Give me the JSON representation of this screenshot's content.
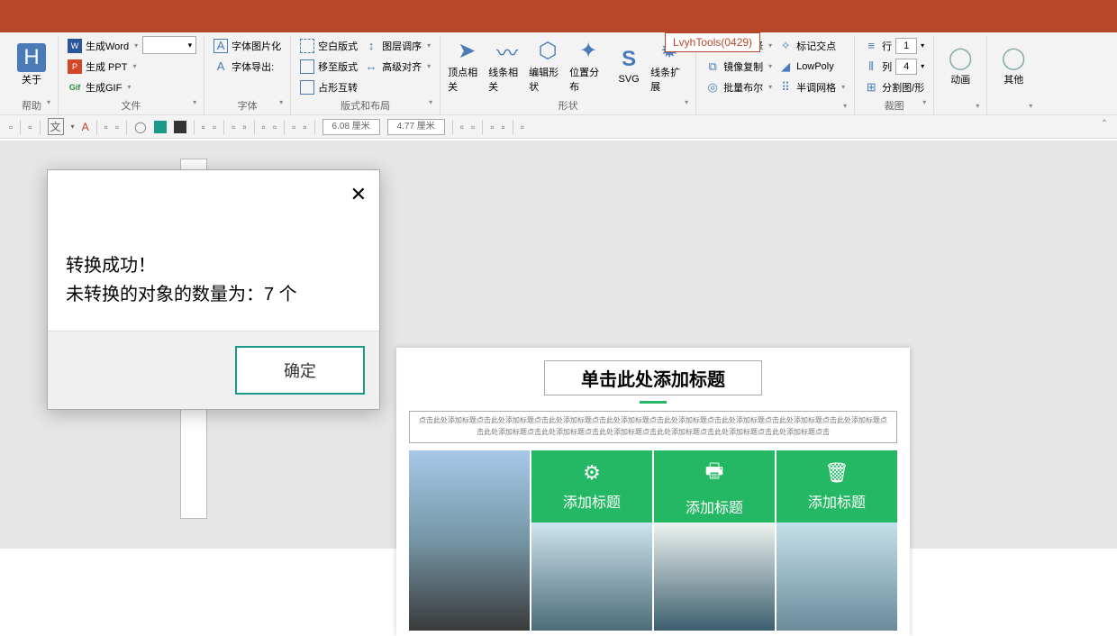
{
  "titlebar": {
    "addin_name": "LvyhTools(0429)"
  },
  "ribbon": {
    "about": {
      "label": "关于"
    },
    "file": {
      "gen_word": "生成Word",
      "gen_ppt": "生成 PPT",
      "gen_gif": "生成GIF",
      "label": "文件"
    },
    "font": {
      "to_image": "字体图片化",
      "export": "字体导出:",
      "label": "字体"
    },
    "layout": {
      "blank": "空白版式",
      "move": "移至版式",
      "swap": "占形互转",
      "layer_order": "图层调序",
      "adv_align": "高级对齐",
      "label": "版式和布局"
    },
    "shape": {
      "vertex": "顶点相关",
      "line": "线条相关",
      "edit": "编辑形状",
      "dist": "位置分布",
      "svg": "SVG",
      "expand": "线条扩展",
      "label": "形状"
    },
    "extras": {
      "special_select": "特殊选择",
      "mark_cross": "标记交点",
      "mirror_copy": "镜像复制",
      "lowpoly": "LowPoly",
      "batch_bool": "批量布尔",
      "halftone": "半调网格"
    },
    "crop": {
      "row": "行",
      "col": "列",
      "split": "分割图/形",
      "row_val": "1",
      "col_val": "4",
      "label": "裁图"
    },
    "anim": {
      "label": "动画"
    },
    "other": {
      "label": "其他"
    },
    "group_help": "帮助"
  },
  "qat": {
    "font_label": "文",
    "dim_w": "6.08 厘米",
    "dim_h": "4.77 厘米"
  },
  "slide": {
    "title": "单击此处添加标题",
    "sub": "点击此处添加标题点击此处添加标题点击此处添加标题点击此处添加标题点击此处添加标题点击此处添加标题点击此处添加标题点击此处添加标题点击此处添加标题点击此处添加标题点击此处添加标题点击此处添加标题点击此处添加标题点击此处添加标题点击",
    "cards": [
      {
        "t": "添加标题"
      },
      {
        "t": "添加标题"
      },
      {
        "t": "添加标题"
      }
    ]
  },
  "modal": {
    "line1": "转换成功！",
    "line2": "未转换的对象的数量为：7 个",
    "ok": "确定"
  }
}
